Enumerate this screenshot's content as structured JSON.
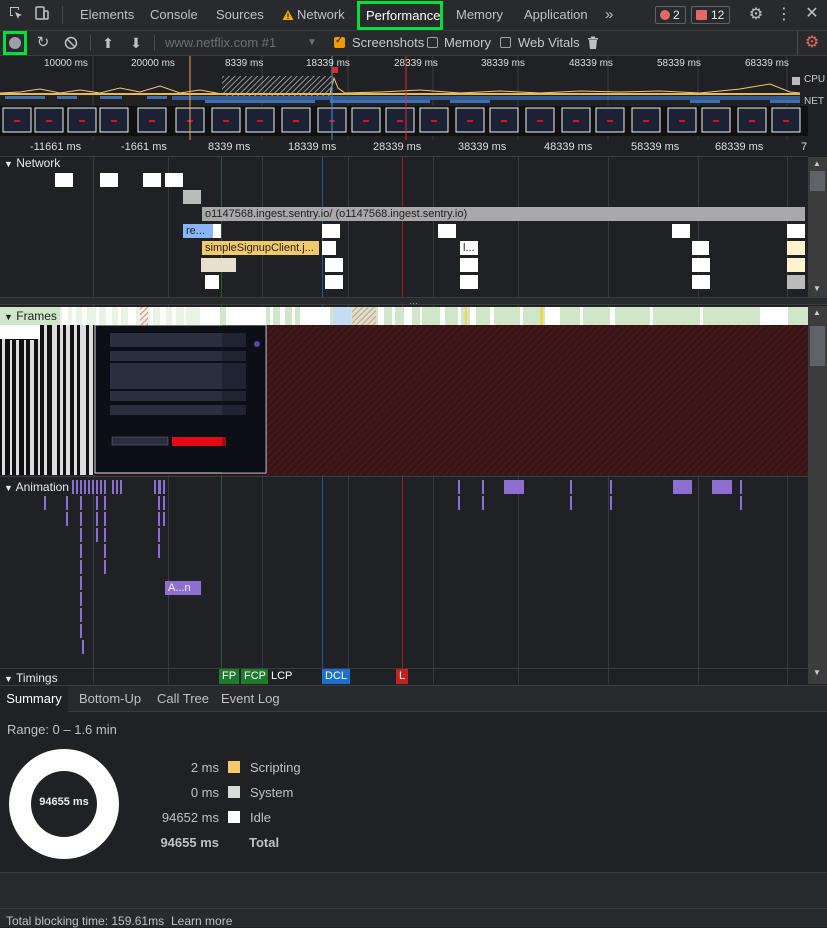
{
  "tabs": {
    "elements": "Elements",
    "console": "Console",
    "sources": "Sources",
    "network": "Network",
    "performance": "Performance",
    "memory": "Memory",
    "application": "Application",
    "more": "»",
    "errors_count": "2",
    "issues_count": "12"
  },
  "toolbar": {
    "url_placeholder": "www.netflix.com #1",
    "screenshots": "Screenshots",
    "memory": "Memory",
    "web_vitals": "Web Vitals",
    "screenshots_checked": true,
    "memory_checked": false,
    "web_vitals_checked": false
  },
  "overview": {
    "ticks": [
      "10000 ms",
      "20000 ms",
      "8339 ms",
      "18339 ms",
      "28339 ms",
      "38339 ms",
      "48339 ms",
      "58339 ms",
      "68339 ms"
    ],
    "cpu_label": "CPU",
    "net_label": "NET"
  },
  "ruler": {
    "ticks": [
      "-11661 ms",
      "-1661 ms",
      "8339 ms",
      "18339 ms",
      "28339 ms",
      "38339 ms",
      "48339 ms",
      "58339 ms",
      "68339 ms",
      "7"
    ]
  },
  "tracks": {
    "network_title": "Network",
    "frames_title": "Frames",
    "animation_title": "Animation",
    "timings_title": "Timings",
    "sentry_request": "o1147568.ingest.sentry.io/ (o1147568.ingest.sentry.io)",
    "re_request": "re...",
    "signup_request": "simpleSignupClient.j...",
    "dots_request": "l...",
    "anim_label": "A...n"
  },
  "timings": {
    "fp": "FP",
    "fcp": "FCP",
    "lcp": "LCP",
    "dcl": "DCL",
    "l": "L"
  },
  "colors": {
    "fp": "#1e7a2e",
    "fcp": "#1e7a2e",
    "dcl": "#1a6fd1",
    "l": "#c5221f",
    "scripting": "#f2c96a",
    "system": "#dadada",
    "idle": "#ffffff",
    "highlight": "#00e03a"
  },
  "bottom_tabs": {
    "summary": "Summary",
    "bottom_up": "Bottom-Up",
    "call_tree": "Call Tree",
    "event_log": "Event Log"
  },
  "summary": {
    "range": "Range: 0 – 1.6 min",
    "donut_total": "94655 ms",
    "rows": [
      {
        "value": "2 ms",
        "label": "Scripting"
      },
      {
        "value": "0 ms",
        "label": "System"
      },
      {
        "value": "94652 ms",
        "label": "Idle"
      }
    ],
    "total_value": "94655 ms",
    "total_label": "Total"
  },
  "footer": {
    "tbt": "Total blocking time: 159.61ms",
    "learn_more": "Learn more"
  }
}
